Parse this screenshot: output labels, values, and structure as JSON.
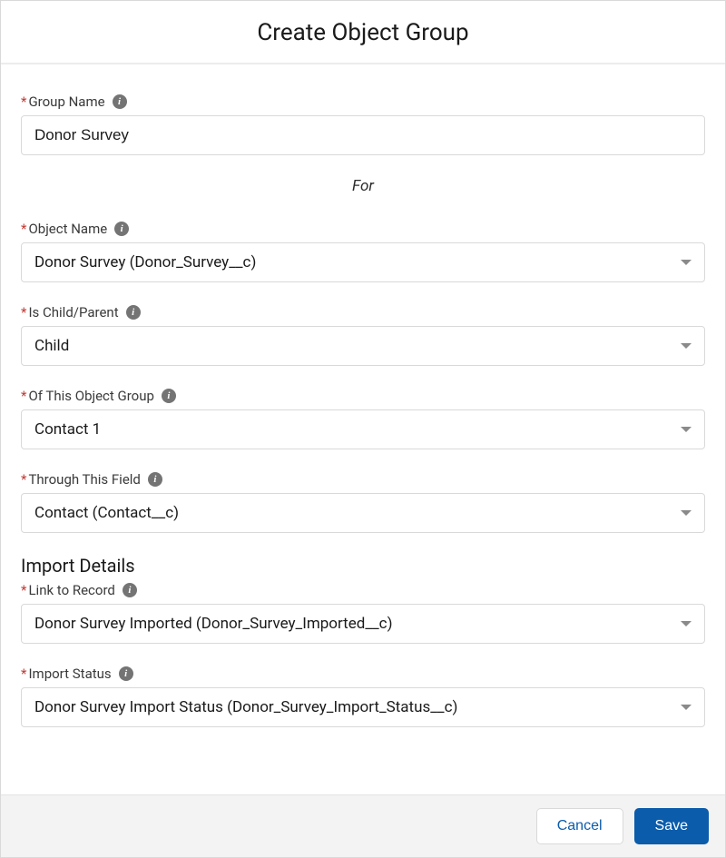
{
  "header": {
    "title": "Create Object Group"
  },
  "fields": {
    "group_name": {
      "label": "Group Name",
      "value": "Donor Survey"
    },
    "for_text": "For",
    "object_name": {
      "label": "Object Name",
      "value": "Donor Survey (Donor_Survey__c)"
    },
    "is_child_parent": {
      "label": "Is Child/Parent",
      "value": "Child"
    },
    "of_group": {
      "label": "Of This Object Group",
      "value": "Contact 1"
    },
    "through_field": {
      "label": "Through This Field",
      "value": "Contact (Contact__c)"
    },
    "section_import": "Import Details",
    "link_record": {
      "label": "Link to Record",
      "value": "Donor Survey Imported (Donor_Survey_Imported__c)"
    },
    "import_status": {
      "label": "Import Status",
      "value": "Donor Survey Import Status (Donor_Survey_Import_Status__c)"
    }
  },
  "footer": {
    "cancel": "Cancel",
    "save": "Save"
  },
  "glyphs": {
    "required": "*",
    "info": "i"
  }
}
